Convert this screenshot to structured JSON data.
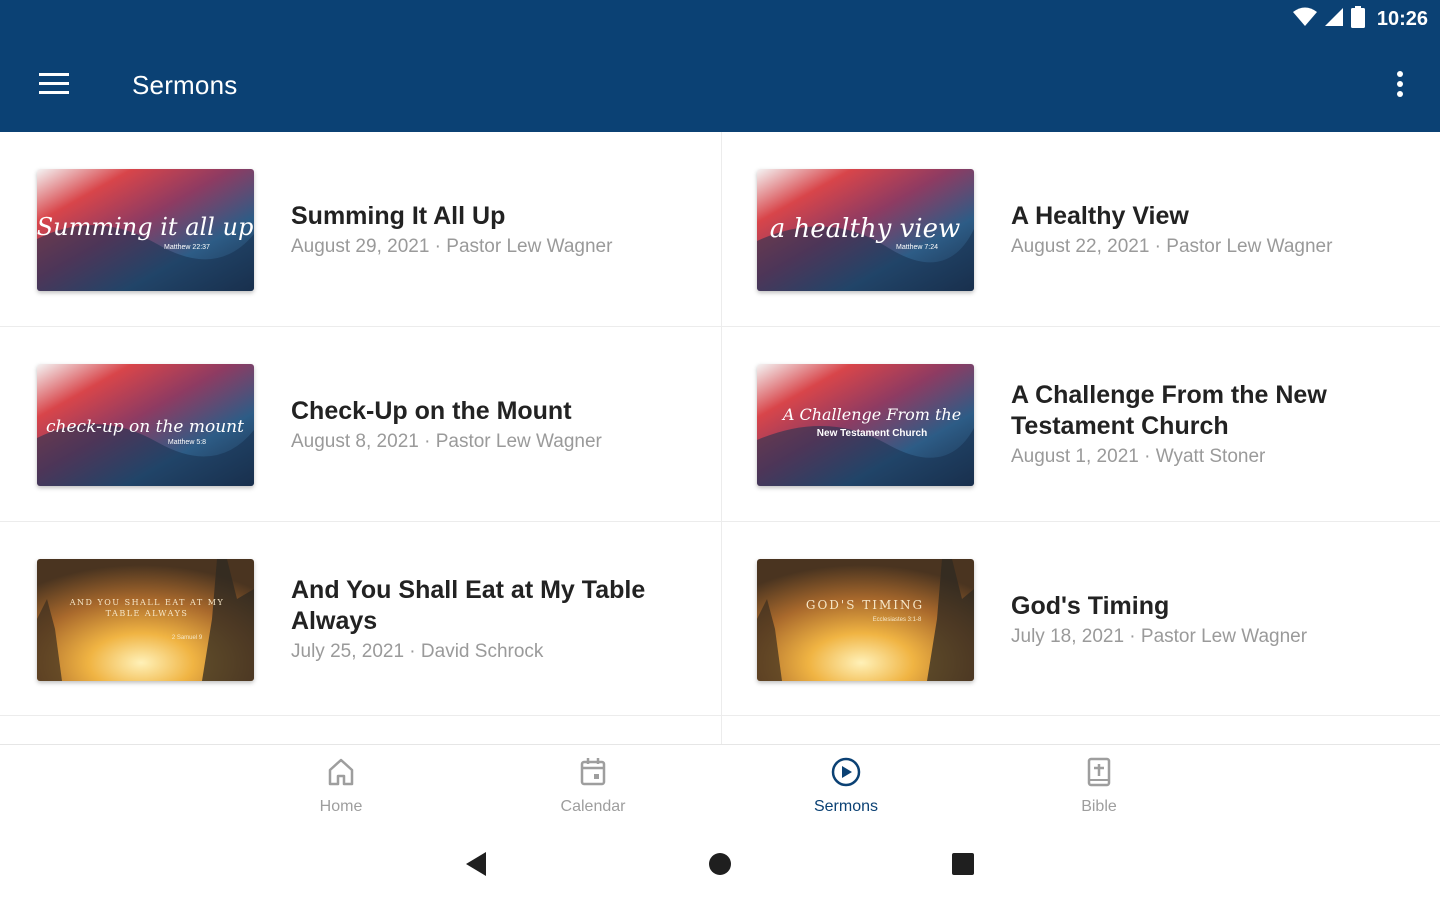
{
  "status_bar": {
    "time": "10:26"
  },
  "app_bar": {
    "title": "Sermons"
  },
  "sermons": [
    {
      "title": "Summing It All Up",
      "meta": "August 29, 2021 · Pastor Lew Wagner",
      "thumb_text": "Summing it all up",
      "thumb_ref": "Matthew 22:37",
      "theme": "red"
    },
    {
      "title": "A Healthy View",
      "meta": "August 22, 2021 · Pastor Lew Wagner",
      "thumb_text": "a healthy view",
      "thumb_ref": "Matthew 7:24",
      "theme": "red"
    },
    {
      "title": "Check-Up on the Mount",
      "meta": "August 8, 2021 · Pastor Lew Wagner",
      "thumb_text": "check-up on the mount",
      "thumb_ref": "Matthew 5:8",
      "theme": "red"
    },
    {
      "title": "A Challenge From the New Testament Church",
      "meta": "August 1, 2021 · Wyatt Stoner",
      "thumb_text": "A Challenge From the",
      "thumb_ref": "New Testament Church",
      "theme": "red"
    },
    {
      "title": "And You Shall Eat at My Table Always",
      "meta": "July 25, 2021 · David Schrock",
      "thumb_text": "AND YOU SHALL EAT AT MY TABLE ALWAYS",
      "thumb_ref": "2 Samuel 9",
      "theme": "gold"
    },
    {
      "title": "God's Timing",
      "meta": "July 18, 2021 · Pastor Lew Wagner",
      "thumb_text": "GOD'S TIMING",
      "thumb_ref": "Ecclesiastes 3:1-8",
      "theme": "gold"
    }
  ],
  "bottom_nav": [
    {
      "label": "Home",
      "icon": "home-icon",
      "active": false
    },
    {
      "label": "Calendar",
      "icon": "calendar-icon",
      "active": false
    },
    {
      "label": "Sermons",
      "icon": "play-circle-icon",
      "active": true
    },
    {
      "label": "Bible",
      "icon": "bible-icon",
      "active": false
    }
  ],
  "colors": {
    "primary": "#0b4174",
    "title_text": "#222222",
    "meta_text": "#9a9a9a",
    "inactive_nav": "#9e9e9e"
  }
}
